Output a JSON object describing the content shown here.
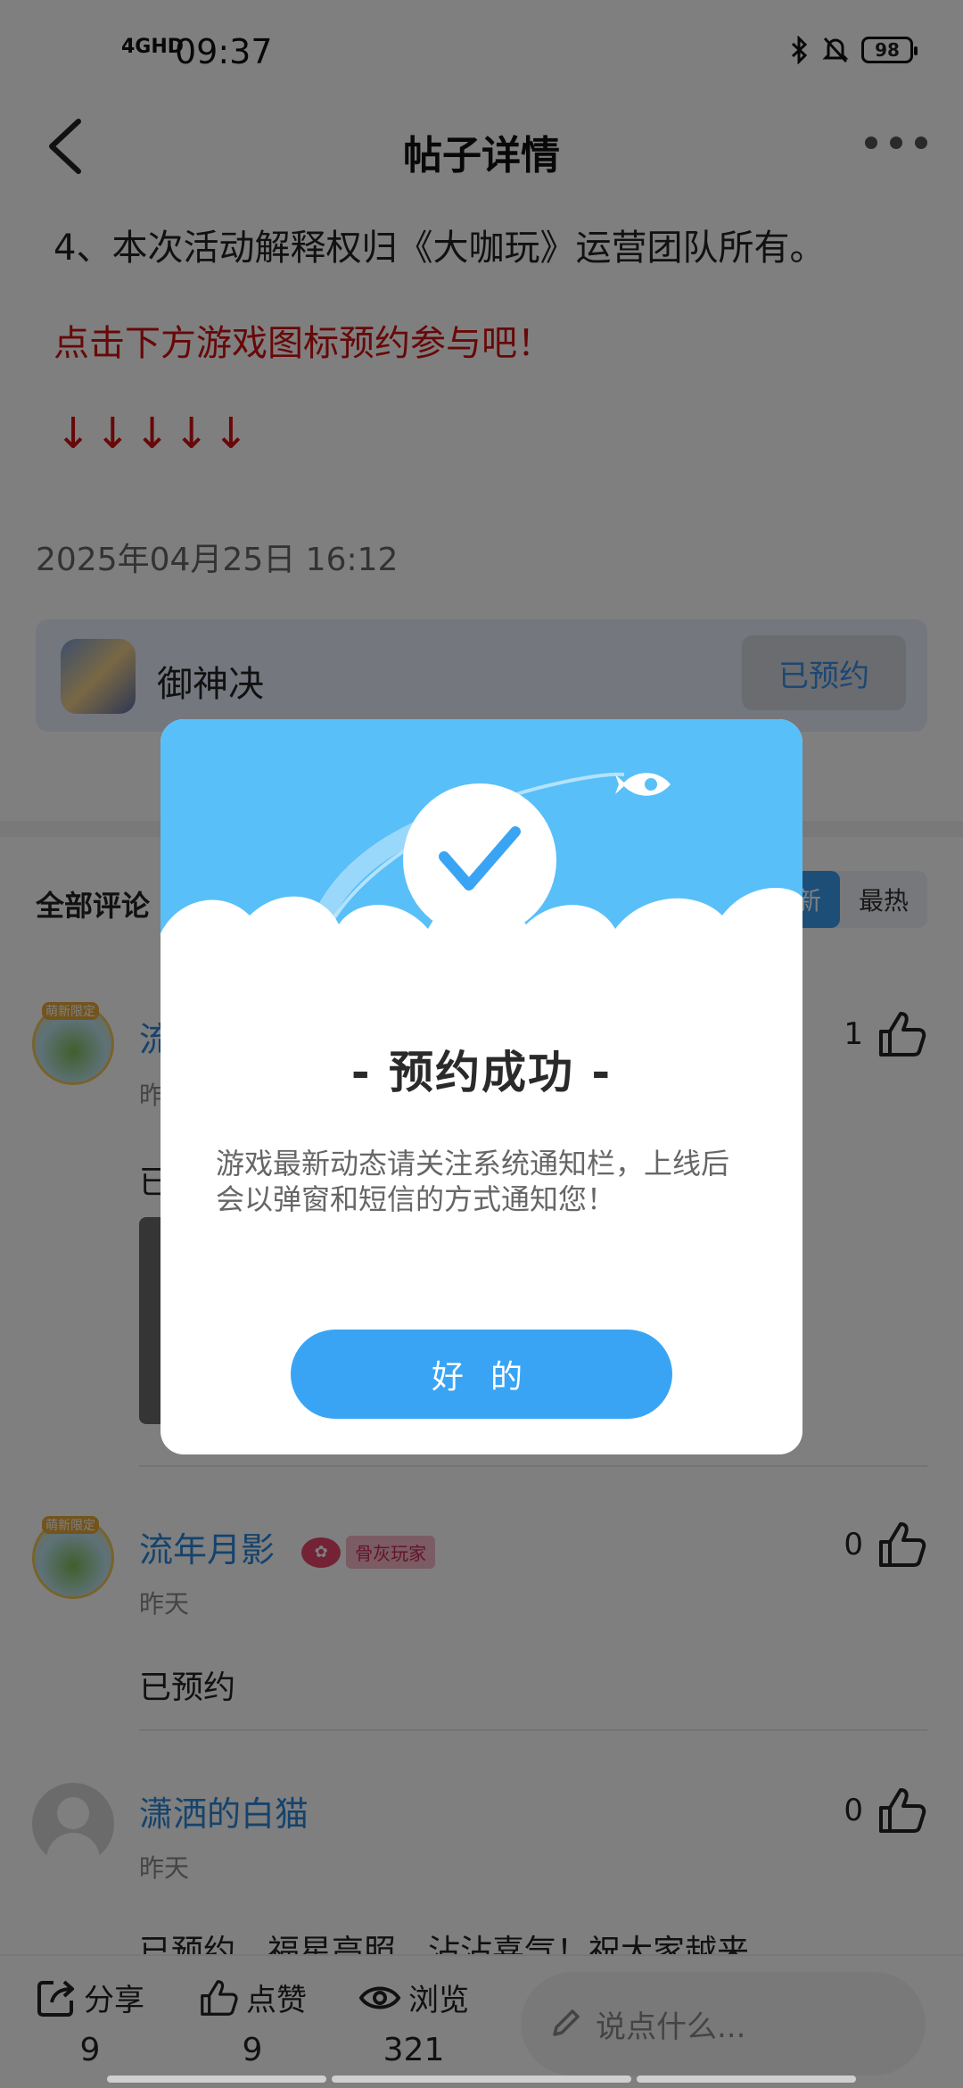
{
  "status_bar": {
    "network": "4GHD",
    "time": "09:37",
    "battery": "98"
  },
  "header": {
    "title": "帖子详情"
  },
  "post": {
    "paragraph_rules": "4、本次活动解释权归《大咖玩》运营团队所有。",
    "call_to_action": "点击下方游戏图标预约参与吧！",
    "arrows": "↓↓↓↓↓",
    "date": "2025年04月25日 16:12"
  },
  "game_card": {
    "name": "御神决",
    "button_label": "已预约"
  },
  "comments_section": {
    "title": "全部评论",
    "sort_tabs": [
      {
        "label": "最新",
        "active": true
      },
      {
        "label": "最热",
        "active": false
      }
    ]
  },
  "comments": [
    {
      "name": "流年月影",
      "time": "昨天",
      "text": "已预约",
      "likes": "1",
      "avatar_badge": "萌新限定"
    },
    {
      "name": "流年月影",
      "time": "昨天",
      "text": "已预约",
      "likes": "0",
      "avatar_badge": "萌新限定",
      "level_text": "骨灰玩家"
    },
    {
      "name": "潇洒的白猫",
      "time": "昨天",
      "text": "已预约，福星高照，沾沾喜气！祝大家越来",
      "likes": "0"
    }
  ],
  "bottom_bar": {
    "share": {
      "label": "分享",
      "count": "9"
    },
    "like": {
      "label": "点赞",
      "count": "9"
    },
    "view": {
      "label": "浏览",
      "count": "321"
    },
    "input_placeholder": "说点什么..."
  },
  "dialog": {
    "title": "- 预约成功 -",
    "message": "游戏最新动态请关注系统通知栏，上线后会以弹窗和短信的方式通知您！",
    "ok_label": "好 的"
  },
  "colors": {
    "accent": "#3aa4f4",
    "dialog_header": "#58bff8",
    "red_text": "#d01010",
    "link_blue": "#2b86d9"
  }
}
